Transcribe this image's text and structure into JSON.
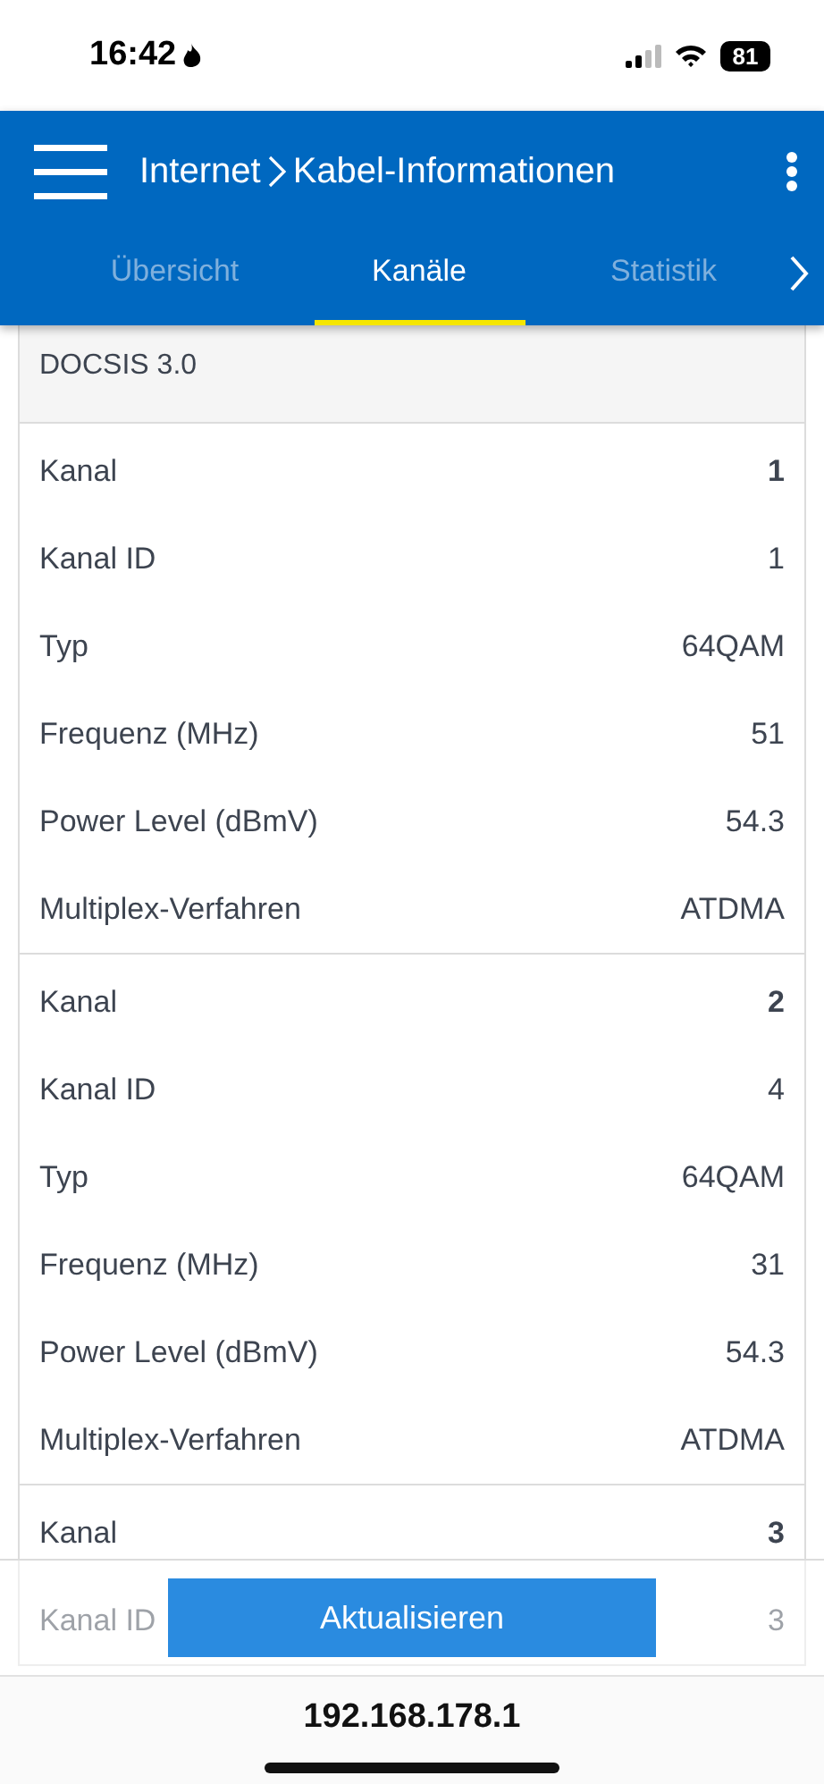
{
  "status_bar": {
    "time": "16:42",
    "battery": "81"
  },
  "header": {
    "title": "Internet",
    "subtitle": "Kabel-Informationen"
  },
  "tabs": [
    {
      "label": "Übersicht",
      "selected": false
    },
    {
      "label": "Kanäle",
      "selected": true
    },
    {
      "label": "Statistik",
      "selected": false
    }
  ],
  "section": {
    "title": "DOCSIS 3.0"
  },
  "channels": [
    {
      "rows": [
        {
          "kind": "head",
          "label": "Kanal",
          "value": "1"
        },
        {
          "kind": "field",
          "label": "Kanal ID",
          "value": "1"
        },
        {
          "kind": "field",
          "label": "Typ",
          "value": "64QAM"
        },
        {
          "kind": "field",
          "label": "Frequenz (MHz)",
          "value": "51"
        },
        {
          "kind": "field",
          "label": "Power Level (dBmV)",
          "value": "54.3"
        },
        {
          "kind": "field",
          "label": "Multiplex-Verfahren",
          "value": "ATDMA"
        }
      ]
    },
    {
      "rows": [
        {
          "kind": "head",
          "label": "Kanal",
          "value": "2"
        },
        {
          "kind": "field",
          "label": "Kanal ID",
          "value": "4"
        },
        {
          "kind": "field",
          "label": "Typ",
          "value": "64QAM"
        },
        {
          "kind": "field",
          "label": "Frequenz (MHz)",
          "value": "31"
        },
        {
          "kind": "field",
          "label": "Power Level (dBmV)",
          "value": "54.3"
        },
        {
          "kind": "field",
          "label": "Multiplex-Verfahren",
          "value": "ATDMA"
        }
      ]
    },
    {
      "rows": [
        {
          "kind": "head",
          "label": "Kanal",
          "value": "3"
        },
        {
          "kind": "field",
          "label": "Kanal ID",
          "value": "3"
        }
      ]
    }
  ],
  "footer": {
    "button": "Aktualisieren"
  },
  "url_bar": {
    "url": "192.168.178.1"
  }
}
